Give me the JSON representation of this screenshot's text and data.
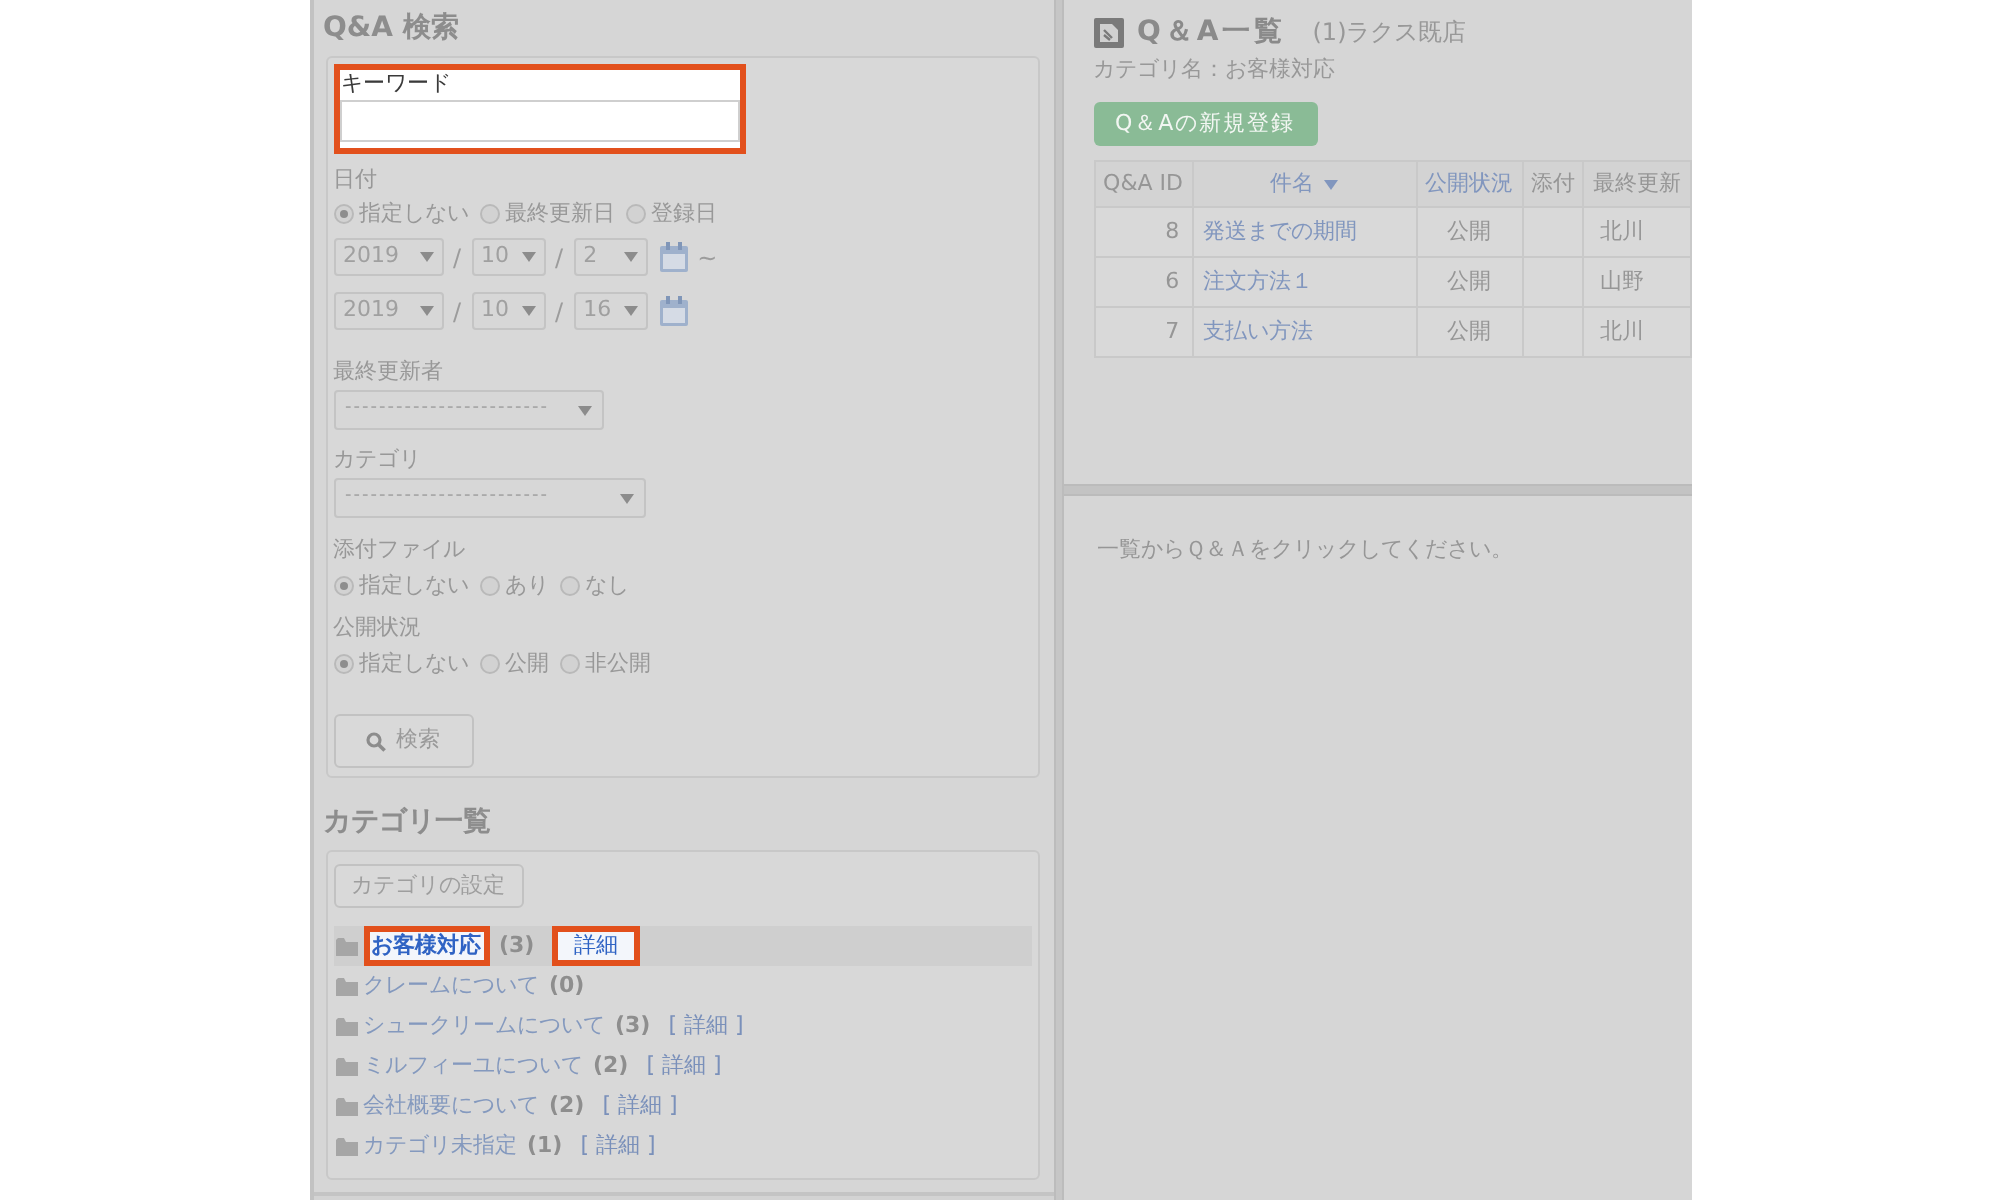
{
  "search_panel": {
    "title": "Q&A 検索",
    "keyword": {
      "label": "キーワード",
      "highlighted": true
    },
    "date": {
      "label": "日付",
      "options": [
        {
          "label": "指定しない",
          "selected": true
        },
        {
          "label": "最終更新日",
          "selected": false
        },
        {
          "label": "登録日",
          "selected": false
        }
      ],
      "ranges": [
        {
          "parts": [
            {
              "kind": "year",
              "value": "2019"
            },
            {
              "kind": "separator",
              "text": "/"
            },
            {
              "kind": "month",
              "value": "10"
            },
            {
              "kind": "separator",
              "text": "/"
            },
            {
              "kind": "day",
              "value": "2"
            },
            {
              "kind": "calendar"
            },
            {
              "kind": "separator",
              "text": "~"
            }
          ]
        },
        {
          "parts": [
            {
              "kind": "year",
              "value": "2019"
            },
            {
              "kind": "separator",
              "text": "/"
            },
            {
              "kind": "month",
              "value": "10"
            },
            {
              "kind": "separator",
              "text": "/"
            },
            {
              "kind": "day",
              "value": "16"
            },
            {
              "kind": "calendar"
            }
          ]
        }
      ]
    },
    "last_updater": {
      "label": "最終更新者",
      "value": "------------------------"
    },
    "category": {
      "label": "カテゴリ",
      "value": "------------------------"
    },
    "attachment": {
      "label": "添付ファイル",
      "options": [
        {
          "label": "指定しない",
          "selected": true
        },
        {
          "label": "あり",
          "selected": false
        },
        {
          "label": "なし",
          "selected": false
        }
      ]
    },
    "publish_status": {
      "label": "公開状況",
      "options": [
        {
          "label": "指定しない",
          "selected": true
        },
        {
          "label": "公開",
          "selected": false
        },
        {
          "label": "非公開",
          "selected": false
        }
      ]
    },
    "search_button": "検索"
  },
  "category_panel": {
    "title": "カテゴリ一覧",
    "settings_button": "カテゴリの設定",
    "items": [
      {
        "name": "お客様対応",
        "count": "(3)",
        "detail": "詳細",
        "selected": true,
        "highlighted": true
      },
      {
        "name": "クレームについて",
        "count": "(0)",
        "selected": false,
        "highlighted": false
      },
      {
        "name": "シュークリームについて",
        "count": "(3)",
        "detail": "[ 詳細 ]",
        "selected": false,
        "highlighted": false
      },
      {
        "name": "ミルフィーユについて",
        "count": "(2)",
        "detail": "[ 詳細 ]",
        "selected": false,
        "highlighted": false
      },
      {
        "name": "会社概要について",
        "count": "(2)",
        "detail": "[ 詳細 ]",
        "selected": false,
        "highlighted": false
      },
      {
        "name": "カテゴリ未指定",
        "count": "(1)",
        "detail": "[ 詳細 ]",
        "selected": false,
        "highlighted": false
      }
    ]
  },
  "qa_list": {
    "title": "Q＆A一覧",
    "store": "(1)ラクス既店",
    "category_line": "カテゴリ名：お客様対応",
    "new_button": "Q＆Aの新規登録",
    "table": {
      "columns": [
        {
          "label": "Q&A ID",
          "kind": "id",
          "link": false,
          "sorted": false
        },
        {
          "label": "件名",
          "kind": "subject",
          "link": true,
          "sorted": true
        },
        {
          "label": "公開状況",
          "kind": "status",
          "link": true,
          "sorted": false
        },
        {
          "label": "添付",
          "kind": "attachment",
          "link": false,
          "sorted": false
        },
        {
          "label": "最終更新",
          "kind": "updated_by",
          "link": false,
          "sorted": false
        }
      ],
      "rows": [
        {
          "id": "8",
          "subject": "発送までの期間",
          "status": "公開",
          "updated_by": "北川"
        },
        {
          "id": "6",
          "subject": "注文方法１",
          "status": "公開",
          "updated_by": "山野"
        },
        {
          "id": "7",
          "subject": "支払い方法",
          "status": "公開",
          "updated_by": "北川"
        }
      ]
    }
  },
  "detail_pane": {
    "message": "一覧からＱ＆Ａをクリックしてください。"
  }
}
